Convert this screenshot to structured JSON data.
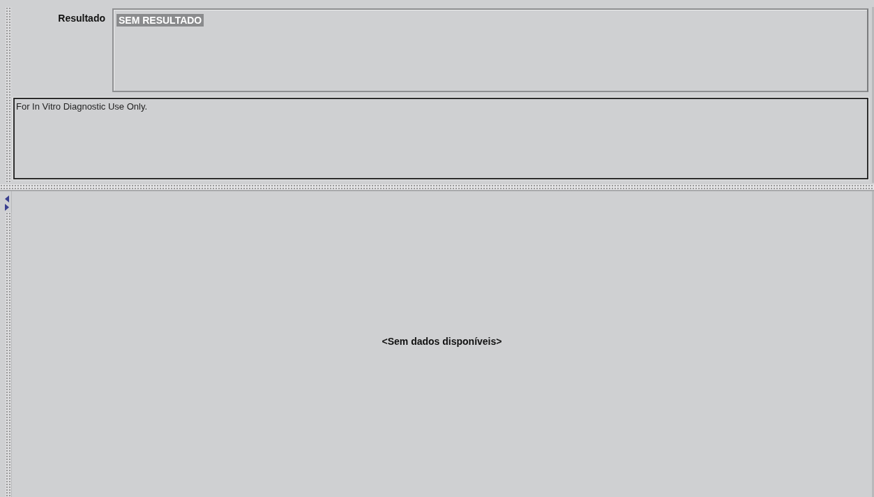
{
  "result": {
    "label": "Resultado",
    "value": "SEM RESULTADO"
  },
  "note": "For In Vitro Diagnostic Use Only.",
  "empty_message": "<Sem dados disponíveis>"
}
